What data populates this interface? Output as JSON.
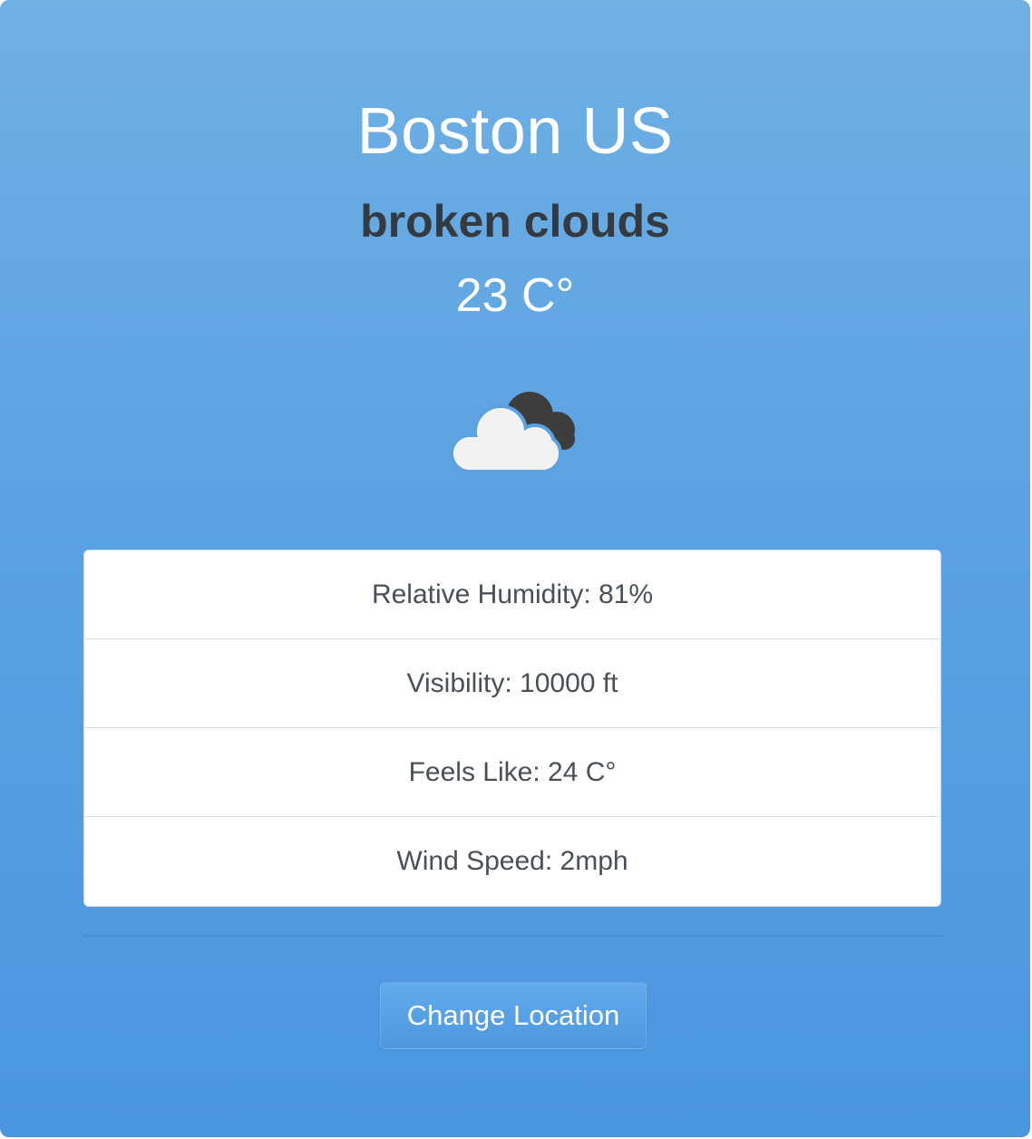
{
  "location": {
    "city": "Boston US",
    "description": "broken clouds",
    "temperature": "23 C°"
  },
  "icon": {
    "name": "broken-clouds-icon",
    "front_cloud_color": "#f2f2f2",
    "back_cloud_color": "#3d3d3d"
  },
  "details": [
    {
      "label": "Relative Humidity: 81%"
    },
    {
      "label": "Visibility: 10000 ft"
    },
    {
      "label": "Feels Like: 24 C°"
    },
    {
      "label": "Wind Speed: 2mph"
    }
  ],
  "actions": {
    "change_location_label": "Change Location"
  },
  "colors": {
    "background_top": "#6fb0e5",
    "background_bottom": "#4a96de",
    "description_text": "#343a40",
    "detail_text": "#495057"
  }
}
